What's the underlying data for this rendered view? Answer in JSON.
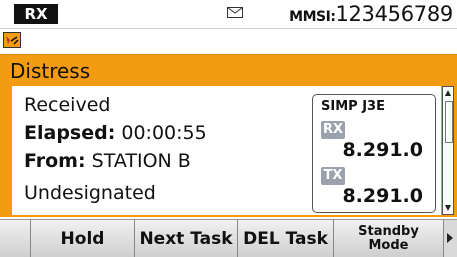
{
  "status": {
    "mode_badge": "RX",
    "mmsi_label": "MMSI:",
    "mmsi_value": "123456789"
  },
  "title": "Distress",
  "info": {
    "status": "Received",
    "elapsed_label": "Elapsed:",
    "elapsed_value": "00:00:55",
    "from_label": "From:",
    "from_value": "STATION B",
    "nature": "Undesignated"
  },
  "frequency": {
    "mode": "SIMP J3E",
    "rx_tag": "RX",
    "rx_value": "8.291.0",
    "tx_tag": "TX",
    "tx_value": "8.291.0"
  },
  "softkeys": {
    "key1": "Hold",
    "key2": "Next Task",
    "key3": "DEL Task",
    "key4_line1": "Standby",
    "key4_line2": "Mode"
  },
  "icons": {
    "mail": "envelope-icon",
    "dsc": "dsc-call-icon",
    "more": "arrow-right-icon"
  },
  "colors": {
    "accent": "#f39c12",
    "tag_gray": "#9aa3ad"
  }
}
